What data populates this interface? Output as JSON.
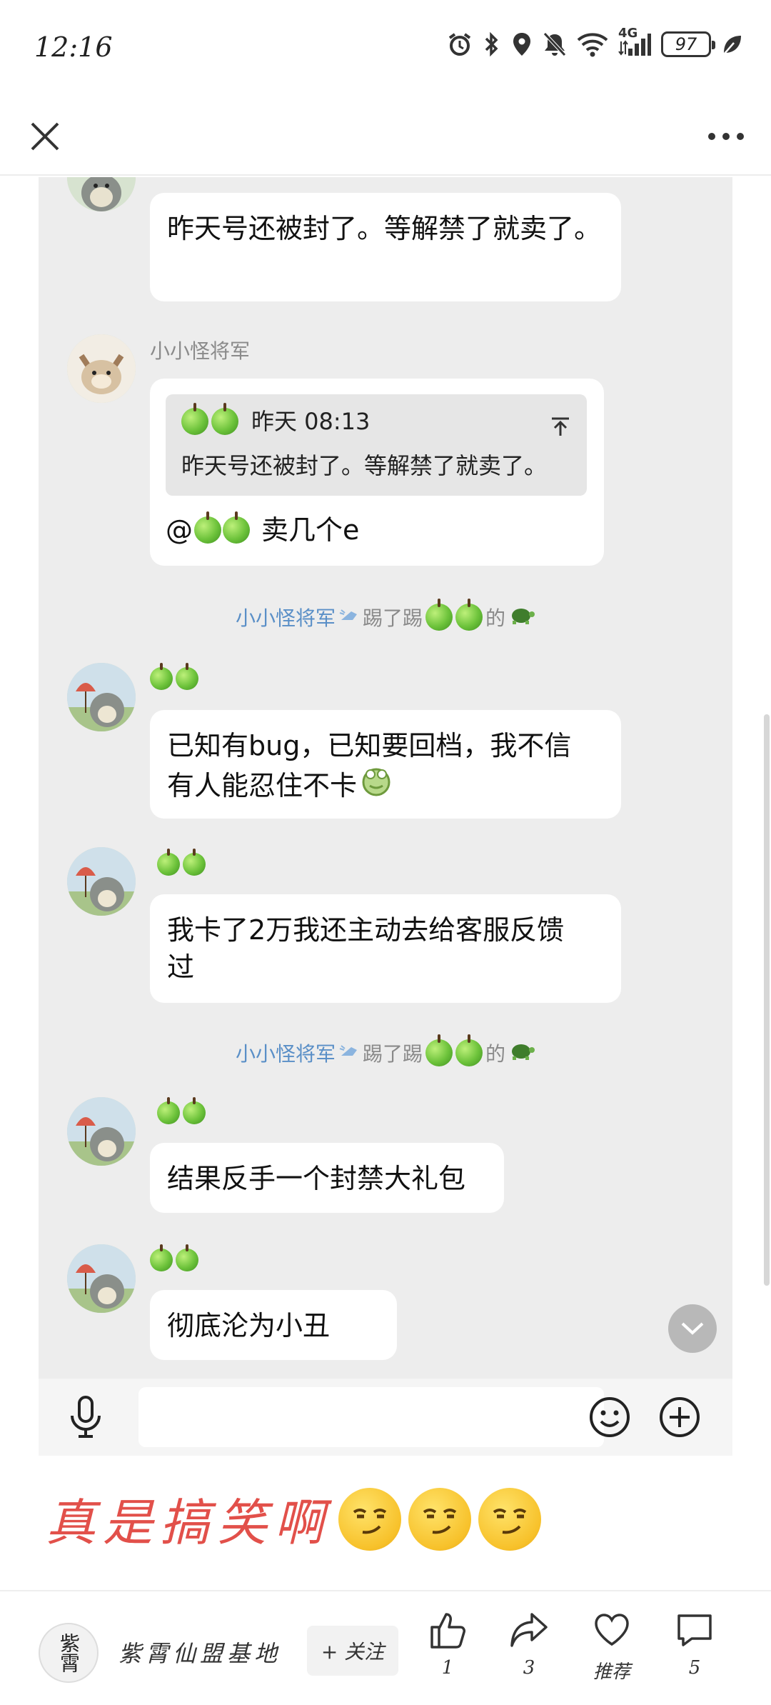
{
  "status_bar": {
    "time": "12:16",
    "network_label": "4G",
    "battery": "97"
  },
  "nav": {
    "close_icon": "close-icon",
    "more_icon": "more-icon"
  },
  "chat": {
    "messages": [
      {
        "text": "昨天号还被封了。等解禁了就卖了。"
      },
      {
        "sender": "小小怪将军",
        "quote_time": "昨天 08:13",
        "quote_text": "昨天号还被封了。等解禁了就卖了。",
        "reply_prefix": "@",
        "reply_suffix": "卖几个e"
      },
      {
        "text_line1": "已知有bug，已知要回档，我不信",
        "text_line2": "有人能忍住不卡"
      },
      {
        "text_line1": "我卡了2万我还主动去给客服反馈",
        "text_line2": "过"
      },
      {
        "text": "结果反手一个封禁大礼包"
      },
      {
        "text": "彻底沦为小丑"
      }
    ],
    "system": {
      "actor": "小小怪将军",
      "action": "踢了踢",
      "suffix": "的"
    }
  },
  "caption": {
    "text": "真是搞笑啊"
  },
  "footer": {
    "author": "紫霄仙盟基地",
    "avatar_text": "紫霄",
    "follow": "+ 关注",
    "likes": "1",
    "shares": "3",
    "recommend": "推荐",
    "comments": "5"
  }
}
